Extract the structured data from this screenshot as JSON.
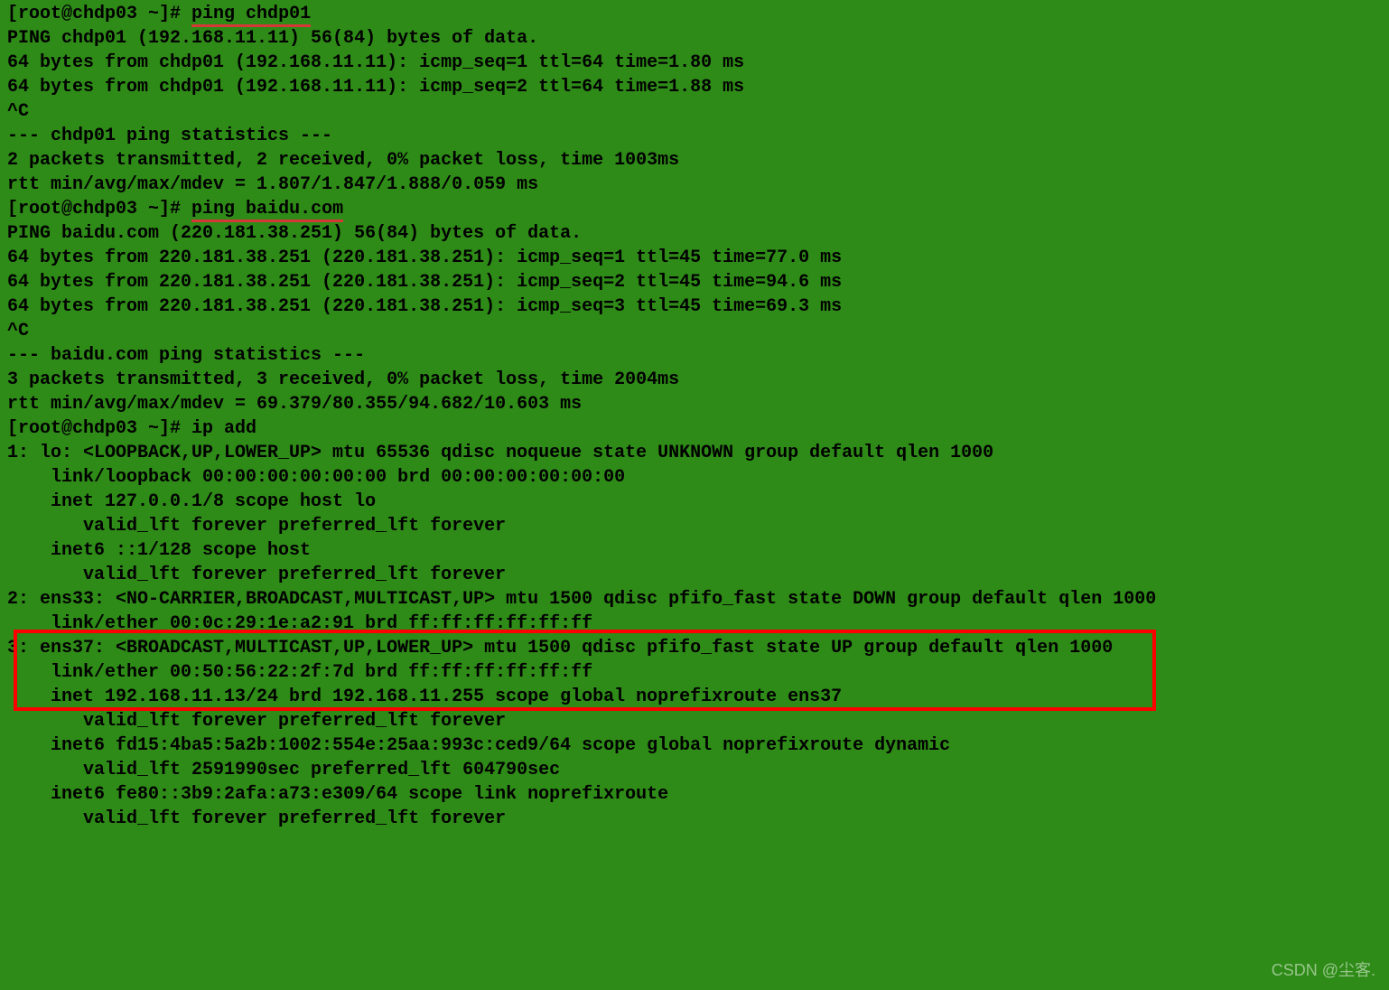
{
  "lines": {
    "prompt1_prefix": "[root@chdp03 ~]# ",
    "cmd1": "ping chdp01",
    "l2": "PING chdp01 (192.168.11.11) 56(84) bytes of data.",
    "l3": "64 bytes from chdp01 (192.168.11.11): icmp_seq=1 ttl=64 time=1.80 ms",
    "l4": "64 bytes from chdp01 (192.168.11.11): icmp_seq=2 ttl=64 time=1.88 ms",
    "l5": "^C",
    "l6": "--- chdp01 ping statistics ---",
    "l7": "2 packets transmitted, 2 received, 0% packet loss, time 1003ms",
    "l8": "rtt min/avg/max/mdev = 1.807/1.847/1.888/0.059 ms",
    "prompt2_prefix": "[root@chdp03 ~]# ",
    "cmd2": "ping baidu.com",
    "l10": "PING baidu.com (220.181.38.251) 56(84) bytes of data.",
    "l11": "64 bytes from 220.181.38.251 (220.181.38.251): icmp_seq=1 ttl=45 time=77.0 ms",
    "l12": "64 bytes from 220.181.38.251 (220.181.38.251): icmp_seq=2 ttl=45 time=94.6 ms",
    "l13": "64 bytes from 220.181.38.251 (220.181.38.251): icmp_seq=3 ttl=45 time=69.3 ms",
    "l14": "^C",
    "l15": "--- baidu.com ping statistics ---",
    "l16": "3 packets transmitted, 3 received, 0% packet loss, time 2004ms",
    "l17": "rtt min/avg/max/mdev = 69.379/80.355/94.682/10.603 ms",
    "l18": "[root@chdp03 ~]# ip add",
    "l19": "1: lo: <LOOPBACK,UP,LOWER_UP> mtu 65536 qdisc noqueue state UNKNOWN group default qlen 1000",
    "l20": "    link/loopback 00:00:00:00:00:00 brd 00:00:00:00:00:00",
    "l21": "    inet 127.0.0.1/8 scope host lo",
    "l22": "       valid_lft forever preferred_lft forever",
    "l23": "    inet6 ::1/128 scope host ",
    "l24": "       valid_lft forever preferred_lft forever",
    "l25": "2: ens33: <NO-CARRIER,BROADCAST,MULTICAST,UP> mtu 1500 qdisc pfifo_fast state DOWN group default qlen 1000",
    "l26": "    link/ether 00:0c:29:1e:a2:91 brd ff:ff:ff:ff:ff:ff",
    "l27": "3: ens37: <BROADCAST,MULTICAST,UP,LOWER_UP> mtu 1500 qdisc pfifo_fast state UP group default qlen 1000",
    "l28": "    link/ether 00:50:56:22:2f:7d brd ff:ff:ff:ff:ff:ff",
    "l29": "    inet 192.168.11.13/24 brd 192.168.11.255 scope global noprefixroute ens37",
    "l30": "       valid_lft forever preferred_lft forever",
    "l31": "    inet6 fd15:4ba5:5a2b:1002:554e:25aa:993c:ced9/64 scope global noprefixroute dynamic ",
    "l32": "       valid_lft 2591990sec preferred_lft 604790sec",
    "l33": "    inet6 fe80::3b9:2afa:a73:e309/64 scope link noprefixroute ",
    "l34": "       valid_lft forever preferred_lft forever"
  },
  "watermark": "CSDN @尘客."
}
